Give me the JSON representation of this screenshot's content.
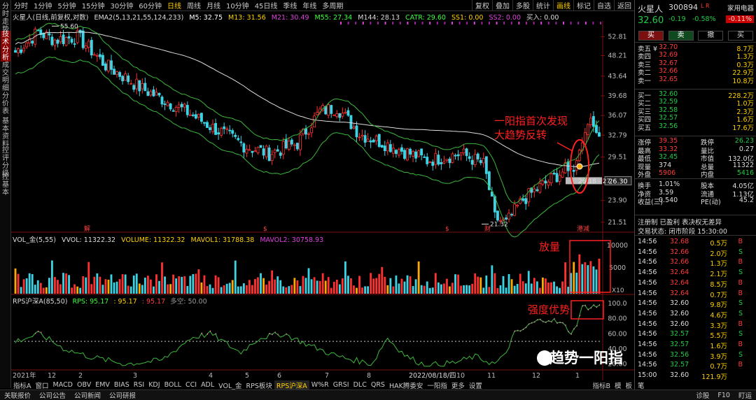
{
  "left_tabs": [
    "分时走势",
    "技术分析",
    "成交明细",
    "分价表",
    "基本资料",
    "控评分级",
    "控基本"
  ],
  "topbar": {
    "periods": [
      "分时",
      "1分钟",
      "5分钟",
      "15分钟",
      "30分钟",
      "60分钟",
      "日线",
      "周线",
      "月线",
      "10分钟",
      "45日线",
      "季线",
      "年线",
      "多周期"
    ],
    "selected": "日线",
    "right": [
      "复权",
      "叠加",
      "多股",
      "统计",
      "画线",
      "标记"
    ],
    "select": "自选",
    "return": "返回"
  },
  "main": {
    "title": "火星人(日线,前复权,对数)",
    "ema": "EMA2(5,13,21,55,124,233)",
    "m5": "M5: 32.75",
    "m13": "M13: 31.56",
    "m21": "M21: 30.49",
    "m55": "M55: 27.34",
    "m144": "M144: 28.13",
    "catr_label": "CATR: 29.60",
    "ss1": "SS1: 0.00",
    "ss2": "SS2: 0.00",
    "buy": "买入: 0.00",
    "y_ticks": [
      "52.81",
      "48.21",
      "43.64",
      "39.68",
      "36.07",
      "32.79",
      "29.51",
      "26.30",
      "23.90",
      "21.51"
    ],
    "high_label": "55.60",
    "low_label": "21.32",
    "recent_low": "26.18 - 27.",
    "price_box": "26.30",
    "marks": [
      "解",
      "$",
      "$",
      "财",
      "港减"
    ],
    "annotation1": "一阳指首次发现",
    "annotation2": "大趋势反转"
  },
  "vol": {
    "label": "VOL_金(5,55)",
    "vvol": "VVOL: 11322.32",
    "volume": "VOLUME: 11322.32",
    "mavol1": "MAVOL1: 31788.38",
    "mavol2": "MAVOL2: 30758.93",
    "y_ticks": [
      "10000",
      "5000"
    ],
    "unit": "X10",
    "annotation": "放量"
  },
  "rps": {
    "label": "RPS沪深A(85,50)",
    "rps": "RPS: 95.17",
    "v1": ": 95.17",
    "v2": ": 95.17",
    "flag": "多空: 50.00",
    "y_ticks": [
      "100.0",
      "80.00",
      "60.00",
      "40.00",
      "20.00"
    ],
    "annotation": "强度优势"
  },
  "xaxis": [
    "2021年",
    "12",
    "2",
    "3",
    "4",
    "5",
    "6",
    "7",
    "8",
    "2022/08/18/四",
    "10",
    "11",
    "12",
    "1"
  ],
  "indicator_tabs": [
    "指标A",
    "窗口",
    "MACD",
    "OBV",
    "EMV",
    "BIAS",
    "RSI",
    "KDJ",
    "BOLL",
    "CCI",
    "ADL",
    "VOL_金",
    "RPS板块",
    "RPS沪深A",
    "W%R",
    "GRSI",
    "DLC",
    "QRS",
    "HAK腾委安",
    "一阳指",
    "更多",
    "设置"
  ],
  "indicator_selected": "RPS沪深A",
  "indicator_right": [
    "指标B",
    "模",
    "板"
  ],
  "statusbar": [
    "关联报价",
    "公司公告",
    "公司新闻",
    "公司研报"
  ],
  "status_right": [
    "诊股",
    "F10",
    "盯运"
  ],
  "watermark": "趋势一阳指",
  "quote": {
    "name": "火星人",
    "code": "300894",
    "tag": "L R",
    "industry": "家用电器",
    "industry_change": "-0.11%",
    "price": "32.60",
    "change": "-0.19",
    "pct": "-0.58%",
    "buttons": [
      "买",
      "卖",
      "撤",
      "买"
    ],
    "asks": [
      [
        "卖五 ¥",
        "32.70",
        "8.7万"
      ],
      [
        "卖四",
        "32.69",
        "1.3万"
      ],
      [
        "卖三",
        "32.67",
        "0.3万"
      ],
      [
        "卖二",
        "32.66",
        "22.9万"
      ],
      [
        "卖一",
        "32.65",
        "10.8万"
      ]
    ],
    "bids": [
      [
        "买一",
        "32.60",
        "228.2万"
      ],
      [
        "买二",
        "32.59",
        "1.0万"
      ],
      [
        "买三",
        "32.58",
        "2.3万"
      ],
      [
        "买四",
        "32.57",
        "1.6万"
      ],
      [
        "买五",
        "32.56",
        "17.6万"
      ]
    ],
    "stats": [
      [
        "涨停",
        "39.35",
        "跌停",
        "26.23"
      ],
      [
        "最高",
        "33.32",
        "量比",
        "0.27"
      ],
      [
        "最低",
        "32.45",
        "市值",
        "132.0亿"
      ],
      [
        "现量",
        "374",
        "总量",
        "11322"
      ],
      [
        "外盘",
        "5906",
        "内盘",
        "5416"
      ],
      [
        "换手",
        "1.01%",
        "股本",
        "4.05亿"
      ],
      [
        "净资",
        "3.59",
        "流通",
        "1.13亿"
      ],
      [
        "收益(三)",
        "0.540",
        "PE(动)",
        "45.2"
      ]
    ],
    "reg": "注册制 已盈利 表决权无差异",
    "trade_status": "交易状态: 闭市阶段 15:30:00",
    "ticks": [
      [
        "14:56",
        "32.68",
        "0.5万",
        "B"
      ],
      [
        "14:56",
        "32.66",
        "2.0万",
        "S"
      ],
      [
        "14:56",
        "32.66",
        "1.3万",
        "B"
      ],
      [
        "14:56",
        "32.64",
        "2.1万",
        "S"
      ],
      [
        "14:56",
        "32.64",
        "8.5万",
        "B"
      ],
      [
        "14:56",
        "32.64",
        "0.7万",
        "B"
      ],
      [
        "14:56",
        "32.60",
        "9.8万",
        "S"
      ],
      [
        "14:56",
        "32.60",
        "4.6万",
        "S"
      ],
      [
        "14:56",
        "32.60",
        "3.3万",
        "B"
      ],
      [
        "14:56",
        "32.57",
        "5.5万",
        "S"
      ],
      [
        "14:56",
        "32.57",
        "1.6万",
        "B"
      ],
      [
        "14:56",
        "32.56",
        "3.9万",
        "S"
      ],
      [
        "14:56",
        "32.57",
        "0.7万",
        "B"
      ],
      [
        "15:00",
        "32.60",
        "121.9万",
        ""
      ]
    ],
    "bottom_tab": "笔"
  }
}
